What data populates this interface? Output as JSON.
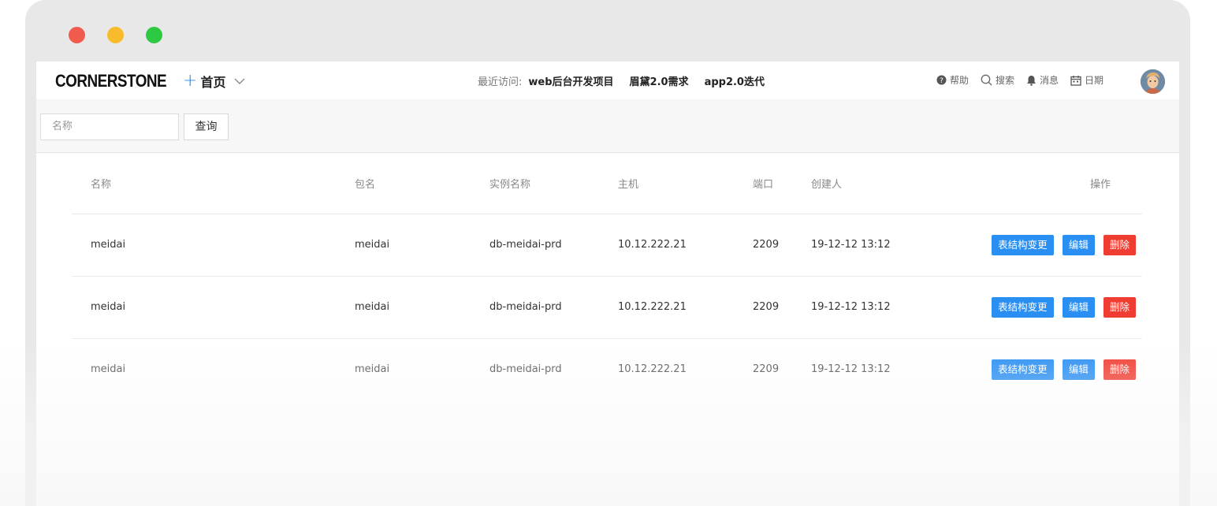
{
  "window": {
    "controls": [
      "close",
      "minimize",
      "maximize"
    ]
  },
  "navbar": {
    "logo": "CORNERSTONE",
    "home_label": "首页",
    "recent_label": "最近访问:",
    "recent_links": [
      "web后台开发项目",
      "眉黛2.0需求",
      "app2.0迭代"
    ],
    "tools": {
      "help": "帮助",
      "search": "搜索",
      "messages": "消息",
      "date": "日期"
    }
  },
  "filter": {
    "placeholder": "名称",
    "query_label": "查询"
  },
  "table": {
    "columns": [
      "名称",
      "包名",
      "实例名称",
      "主机",
      "端口",
      "创建人",
      "操作"
    ],
    "rows": [
      {
        "name": "meidai",
        "package": "meidai",
        "instance": "db-meidai-prd",
        "host": "10.12.222.21",
        "port": "2209",
        "creator": "19-12-12 13:12"
      },
      {
        "name": "meidai",
        "package": "meidai",
        "instance": "db-meidai-prd",
        "host": "10.12.222.21",
        "port": "2209",
        "creator": "19-12-12 13:12"
      },
      {
        "name": "meidai",
        "package": "meidai",
        "instance": "db-meidai-prd",
        "host": "10.12.222.21",
        "port": "2209",
        "creator": "19-12-12 13:12"
      }
    ],
    "actions": {
      "alter": "表结构变更",
      "edit": "编辑",
      "delete": "删除"
    }
  },
  "colors": {
    "accent": "#2a8ff2",
    "danger": "#f03d32"
  }
}
